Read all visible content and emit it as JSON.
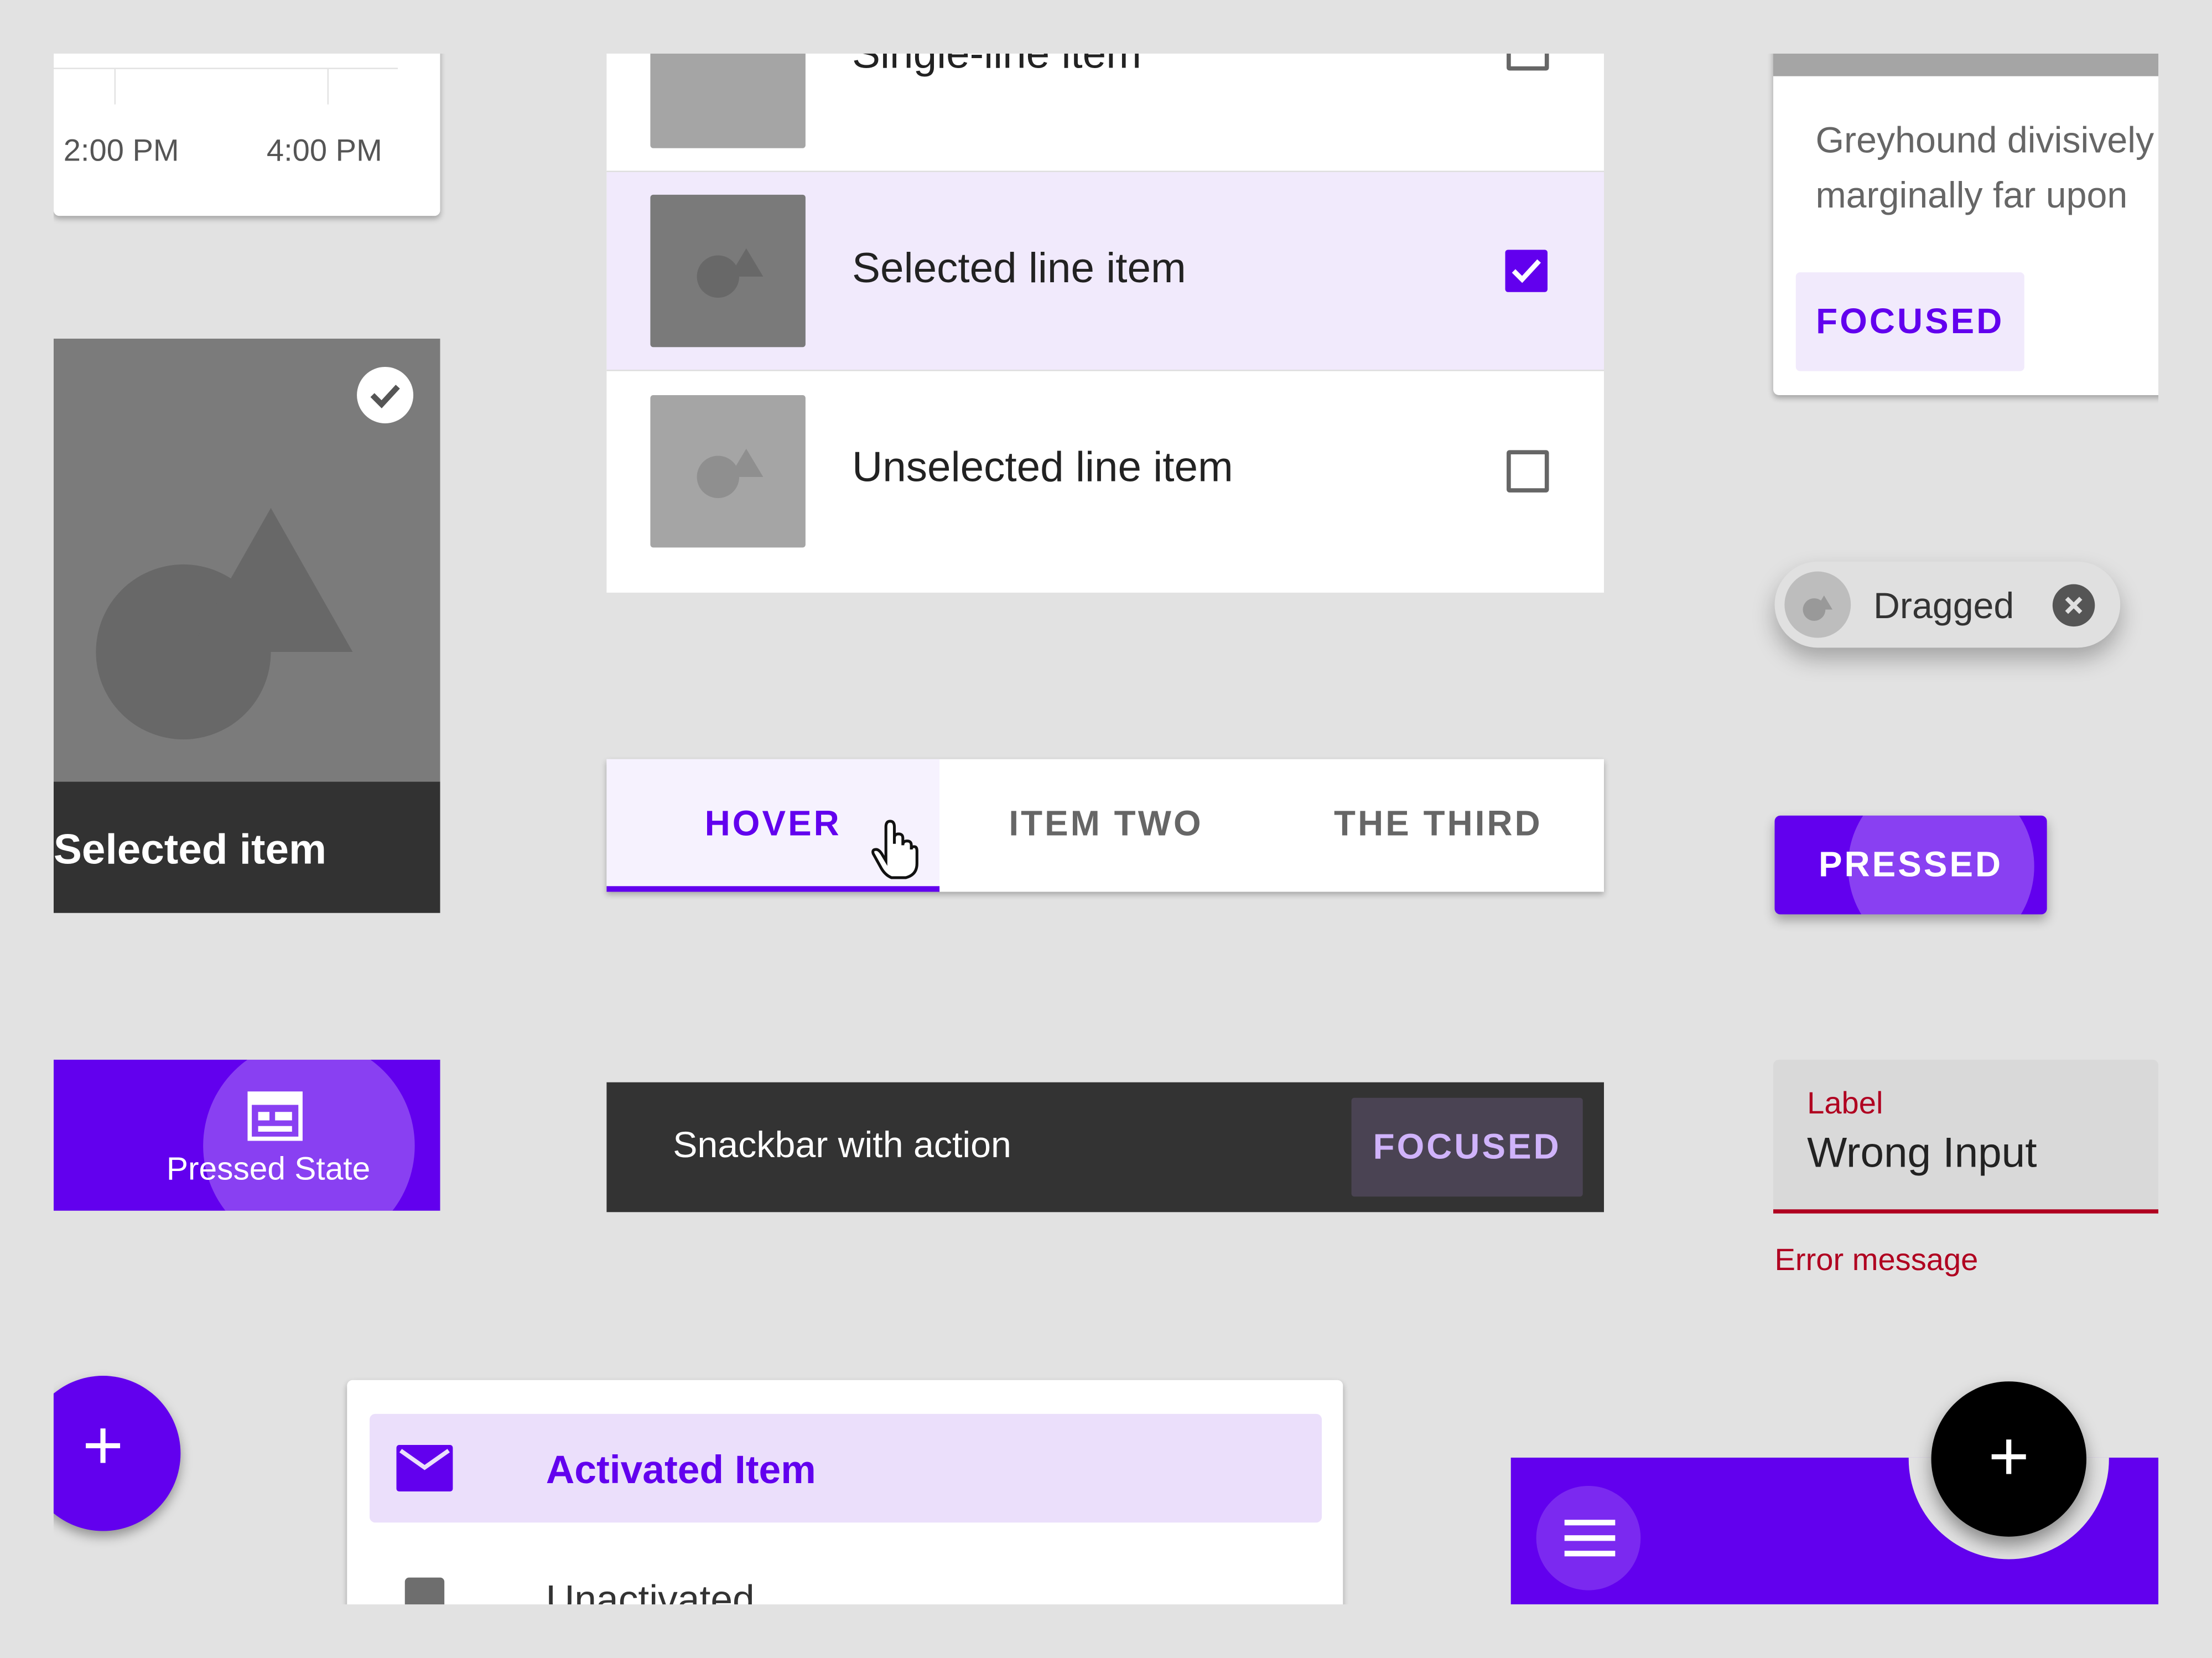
{
  "time_picker": {
    "times": [
      "2:00 PM",
      "4:00 PM"
    ]
  },
  "image_list": {
    "selected_label": "Selected item"
  },
  "bottom_nav": {
    "pressed_label": "Pressed State"
  },
  "fab_left": {
    "glyph": "+"
  },
  "list": {
    "items": [
      {
        "label": "Single-line item",
        "checked": false
      },
      {
        "label": "Selected line item",
        "checked": true
      },
      {
        "label": "Unselected line item",
        "checked": false
      }
    ]
  },
  "tabs": {
    "items": [
      "HOVER",
      "ITEM TWO",
      "THE THIRD"
    ],
    "active": "HOVER"
  },
  "snackbar": {
    "message": "Snackbar with action",
    "action": "FOCUSED"
  },
  "drawer": {
    "activated": "Activated Item",
    "unactivated": "Unactivated"
  },
  "card_text": {
    "line1": "Greyhound divisively",
    "line2": "marginally far upon",
    "button": "FOCUSED"
  },
  "chip": {
    "label": "Dragged"
  },
  "pressed_button": {
    "label": "PRESSED"
  },
  "text_field": {
    "label": "Label",
    "value": "Wrong Input",
    "error": "Error message"
  },
  "bottom_app_bar": {
    "fab_glyph": "+"
  },
  "colors": {
    "primary": "#6200ee",
    "error": "#b00020",
    "dark": "#333333",
    "selected_bg": "#f1eafc"
  }
}
